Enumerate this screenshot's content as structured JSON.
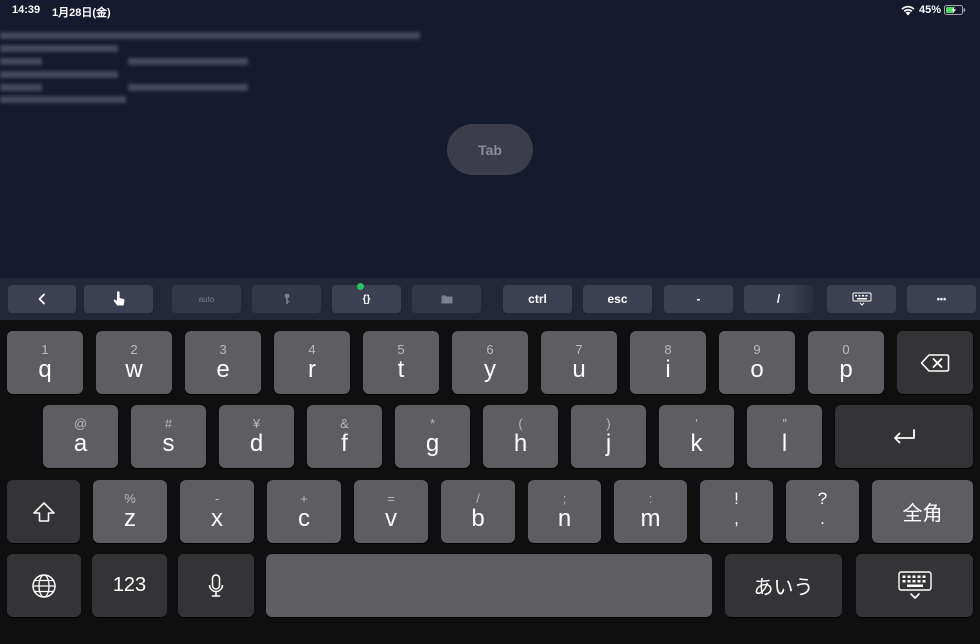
{
  "status_bar": {
    "time": "14:39",
    "date": "1月28日(金)",
    "battery": "45%",
    "wifi_icon": "wifi-icon",
    "battery_icon": "battery-charging-icon"
  },
  "overlay": {
    "tab_label": "Tab"
  },
  "accessory_bar": {
    "back_icon": "chevron-left-icon",
    "touch_icon": "touch-pointer-icon",
    "auto_label": "auto",
    "key_icon": "key-icon",
    "braces_label": "{}",
    "folder_icon": "folder-icon",
    "ctrl_label": "ctrl",
    "esc_label": "esc",
    "dash_label": "-",
    "slash_label": "/",
    "keyboard_icon": "keyboard-icon",
    "more_label": "•••",
    "colors": {
      "active_dot": "#22c55e"
    }
  },
  "keyboard": {
    "row1": [
      {
        "hint": "1",
        "char": "q"
      },
      {
        "hint": "2",
        "char": "w"
      },
      {
        "hint": "3",
        "char": "e"
      },
      {
        "hint": "4",
        "char": "r"
      },
      {
        "hint": "5",
        "char": "t"
      },
      {
        "hint": "6",
        "char": "y"
      },
      {
        "hint": "7",
        "char": "u"
      },
      {
        "hint": "8",
        "char": "i"
      },
      {
        "hint": "9",
        "char": "o"
      },
      {
        "hint": "0",
        "char": "p"
      }
    ],
    "row2": [
      {
        "hint": "@",
        "char": "a"
      },
      {
        "hint": "#",
        "char": "s"
      },
      {
        "hint": "¥",
        "char": "d"
      },
      {
        "hint": "&",
        "char": "f"
      },
      {
        "hint": "*",
        "char": "g"
      },
      {
        "hint": "(",
        "char": "h"
      },
      {
        "hint": ")",
        "char": "j"
      },
      {
        "hint": "′",
        "char": "k"
      },
      {
        "hint": "″",
        "char": "l"
      }
    ],
    "row3": [
      {
        "hint": "%",
        "char": "z"
      },
      {
        "hint": "-",
        "char": "x"
      },
      {
        "hint": "+",
        "char": "c"
      },
      {
        "hint": "=",
        "char": "v"
      },
      {
        "hint": "/",
        "char": "b"
      },
      {
        "hint": ";",
        "char": "n"
      },
      {
        "hint": ":",
        "char": "m"
      },
      {
        "hint": "!",
        "char": ","
      },
      {
        "hint": "?",
        "char": "."
      }
    ],
    "zenkaku_label": "全角",
    "numbers_label": "123",
    "kana_label": "あいう",
    "delete_icon": "backspace-icon",
    "return_icon": "return-icon",
    "shift_icon": "shift-icon",
    "globe_icon": "globe-icon",
    "mic_icon": "microphone-icon",
    "hide_keyboard_icon": "keyboard-hide-icon"
  }
}
